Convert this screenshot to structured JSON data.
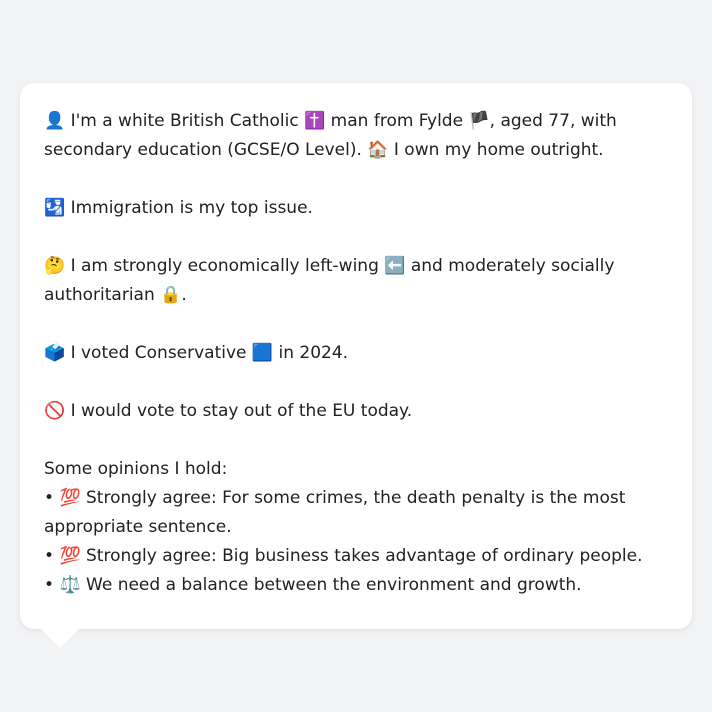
{
  "profile": {
    "intro": {
      "icon": "👤",
      "text1": " I'm a white British Catholic ",
      "icon2": "✝️",
      "text2": " man from Fylde ",
      "icon3": "🏴",
      "text3": ", aged 77, with secondary education (GCSE/O Level). ",
      "icon4": "🏠",
      "text4": " I own my home outright."
    },
    "top_issue": {
      "icon": "🛂",
      "text": " Immigration is my top issue."
    },
    "ideology": {
      "icon": "🤔",
      "text1": " I am strongly economically left-wing ",
      "icon2": "⬅️",
      "text2": " and moderately socially authoritarian ",
      "icon3": "🔒",
      "text3": "."
    },
    "vote": {
      "icon": "🗳️",
      "text1": " I voted Conservative ",
      "icon2": "🟦",
      "text2": " in 2024."
    },
    "eu": {
      "icon": "🚫",
      "text": " I would vote to stay out of the EU today."
    },
    "opinions_heading": "Some opinions I hold:",
    "opinions": [
      {
        "bullet": "• ",
        "icon": "💯",
        "text": " Strongly agree: For some crimes, the death penalty is the most appropriate sentence."
      },
      {
        "bullet": "• ",
        "icon": "💯",
        "text": " Strongly agree: Big business takes advantage of ordinary people."
      },
      {
        "bullet": "• ",
        "icon": "⚖️",
        "text": " We need a balance between the environment and growth."
      }
    ]
  },
  "colors": {
    "background": "#f2f3f5",
    "bubble": "#ffffff",
    "text": "#202124"
  }
}
